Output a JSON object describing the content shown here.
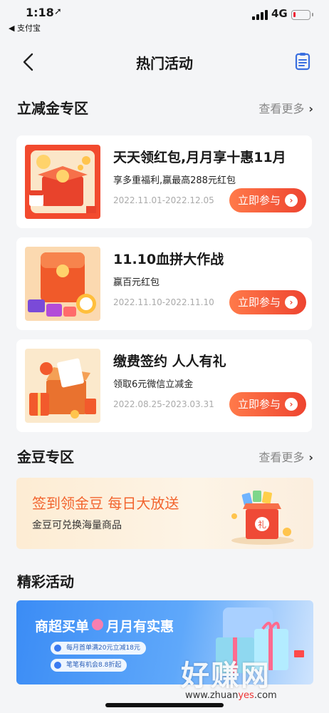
{
  "status_bar": {
    "time": "1:18",
    "location_glyph": "➚",
    "back_app": "◀ 支付宝",
    "network": "4G",
    "battery_level": 0.1
  },
  "nav": {
    "title": "热门活动",
    "back_icon": "chevron-left-icon",
    "right_icon": "document-list-icon"
  },
  "sections": {
    "coupon": {
      "title": "立减金专区",
      "more": "查看更多",
      "chevron": "›"
    },
    "bean": {
      "title": "金豆专区",
      "more": "查看更多",
      "chevron": "›"
    },
    "featured": {
      "title": "精彩活动"
    }
  },
  "cards": [
    {
      "title": "天天领红包,月月享十惠11月",
      "subtitle": "享多重福利,赢最高288元红包",
      "date": "2022.11.01-2022.12.05",
      "button": "立即参与"
    },
    {
      "title": "11.10血拼大作战",
      "subtitle": "赢百元红包",
      "date": "2022.11.10-2022.11.10",
      "button": "立即参与"
    },
    {
      "title": "缴费签约 人人有礼",
      "subtitle": "领取6元微信立减金",
      "date": "2022.08.25-2023.03.31",
      "button": "立即参与"
    }
  ],
  "button_arrow": "›",
  "bean_banner": {
    "title": "签到领金豆  每日大放送",
    "subtitle": "金豆可兑换海量商品",
    "gift_char": "礼"
  },
  "promo": {
    "title_a": "商超买单",
    "title_b": "月月有实惠",
    "item1": "每月首单满20元立减18元",
    "item2": "笔笔有机会8.8折起"
  },
  "watermark": {
    "brand": "好赚网",
    "url_a": "www.zhuan",
    "url_b": "yes",
    "url_c": ".com"
  },
  "colors": {
    "accent": "#ee4430",
    "background": "#f4f5f7",
    "link_gray": "#888888",
    "nav_icon": "#3a6fe0"
  }
}
